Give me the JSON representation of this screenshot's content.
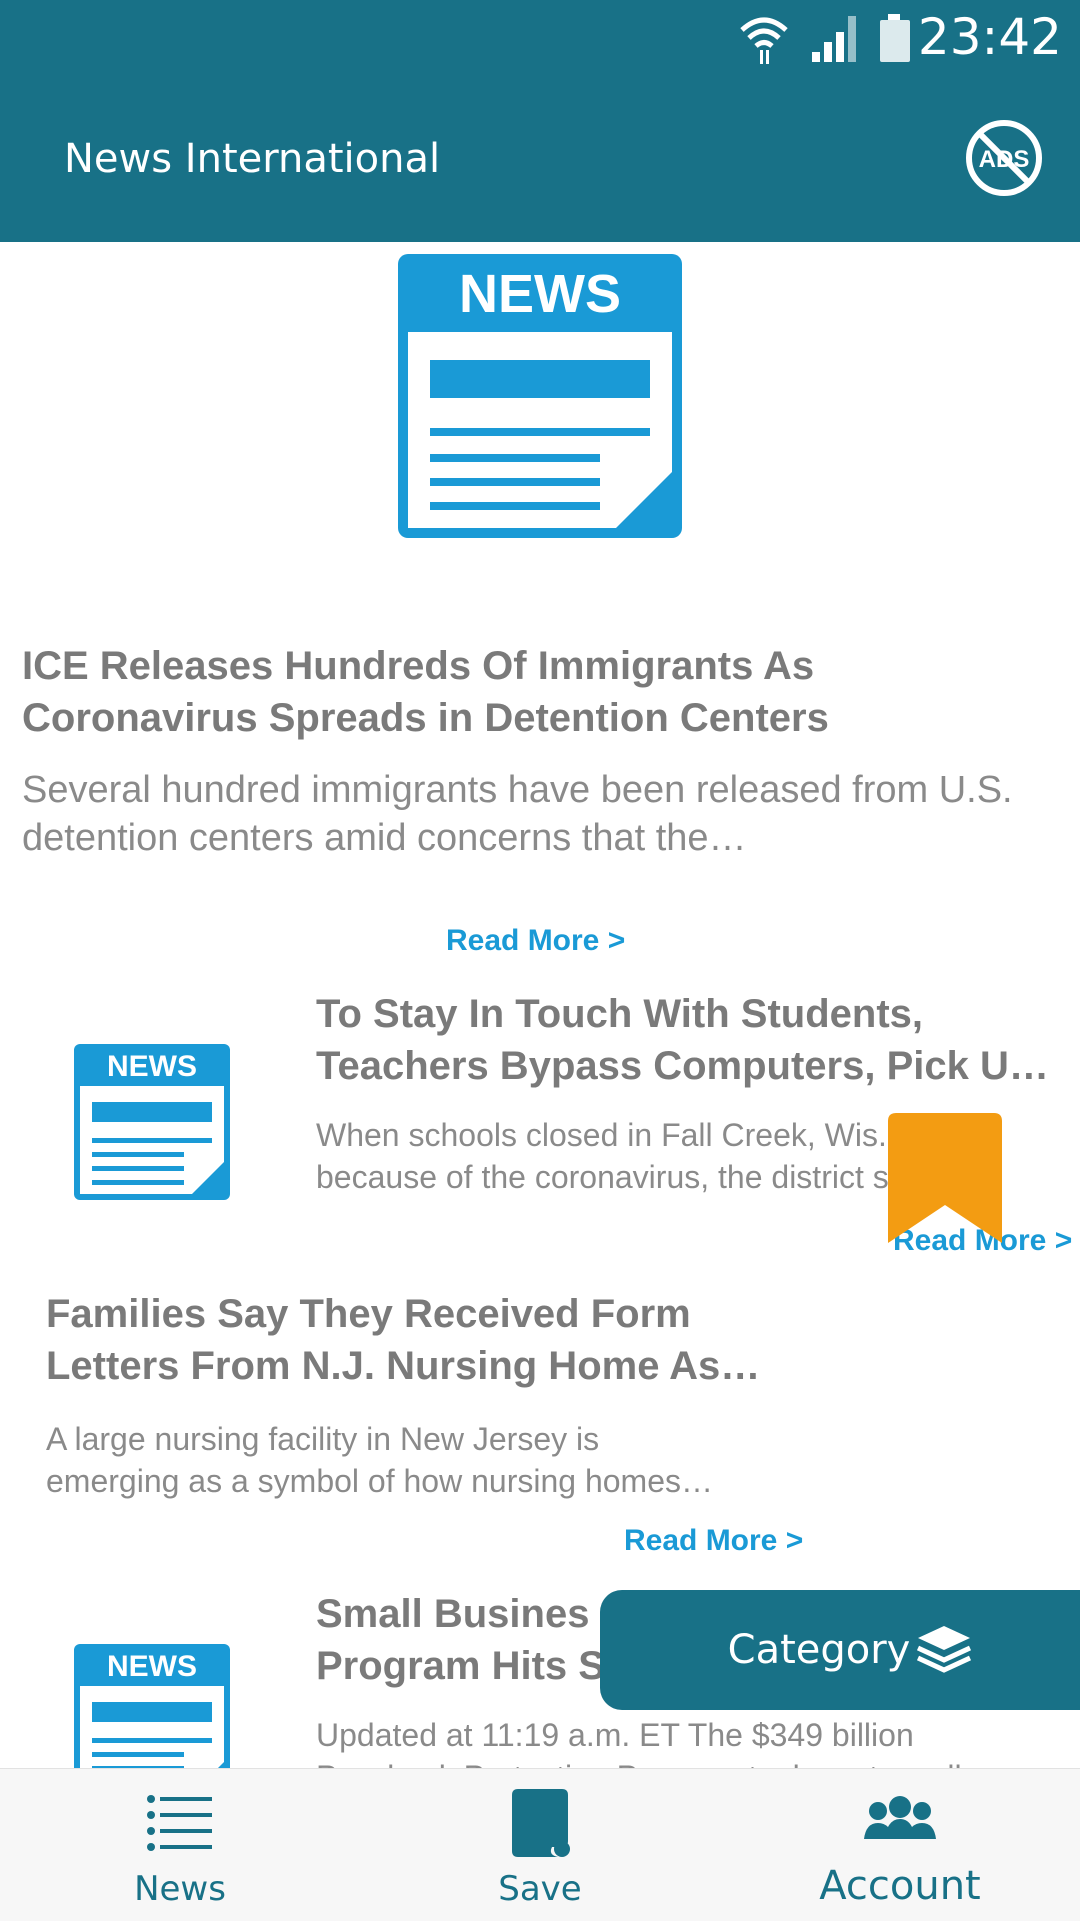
{
  "status_bar": {
    "time": "23:42"
  },
  "app_bar": {
    "title": "News International",
    "no_ads_label": "ADS"
  },
  "hero": {
    "image_label": "NEWS",
    "title": "ICE Releases Hundreds Of Immigrants As Coronavirus Spreads in Detention Centers",
    "description": "Several hundred immigrants have been released from U.S. detention centers amid concerns that the…",
    "read_more": "Read More >"
  },
  "articles": [
    {
      "thumb_label": "NEWS",
      "title_line1": "To Stay In Touch With Students,",
      "title_line2": "Teachers Bypass Computers, Pick U…",
      "desc_line1": "When schools closed in Fall Creek, Wis.,",
      "desc_line2": "because of the coronavirus, the district staff…",
      "read_more": "Read More >"
    },
    {
      "title_line1": "Families Say They Received Form",
      "title_line2": "Letters From N.J. Nursing Home As…",
      "desc_line1": "A large nursing facility in New Jersey is",
      "desc_line2": "emerging as a symbol of how nursing homes…",
      "read_more": "Read More >"
    },
    {
      "thumb_label": "NEWS",
      "title_line1": "Small Busines",
      "title_line2": "Program Hits S",
      "desc_line1": "Updated at 11:19 a.m. ET The $349 billion",
      "desc_line2": "Paycheck Protection Program took next small"
    }
  ],
  "category_button": {
    "label": "Category"
  },
  "bottom_nav": {
    "items": [
      {
        "label": "News"
      },
      {
        "label": "Save"
      },
      {
        "label": "Account"
      }
    ]
  },
  "colors": {
    "primary": "#187187",
    "accent_blue": "#1a9ad6",
    "bookmark": "#f39c12"
  }
}
